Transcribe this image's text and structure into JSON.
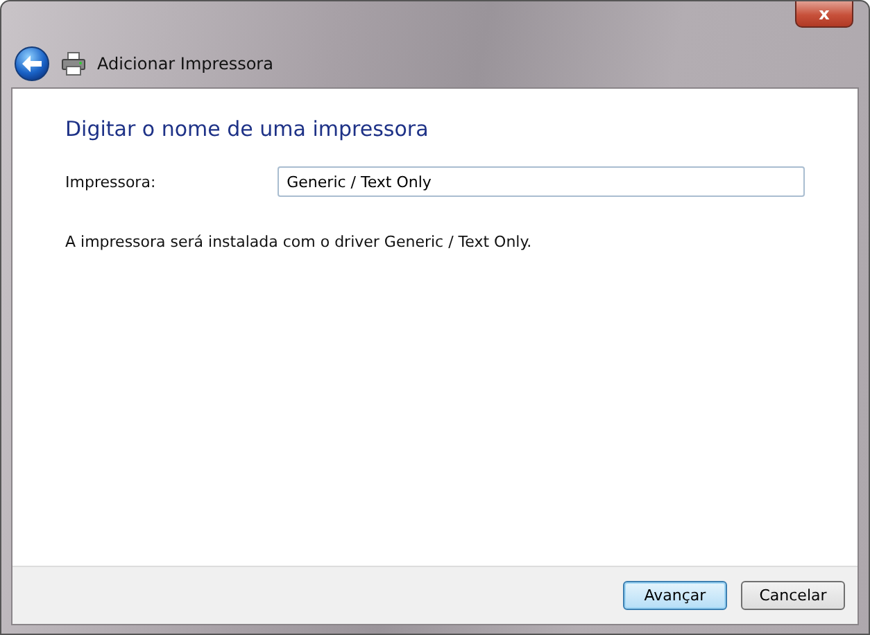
{
  "window": {
    "title": "Adicionar Impressora",
    "close": "x"
  },
  "heading": "Digitar o nome de uma impressora",
  "printer_field": {
    "label": "Impressora:",
    "value": "Generic / Text Only"
  },
  "info": "A impressora será instalada com o driver Generic / Text Only.",
  "buttons": [
    {
      "label": "Avançar",
      "kind": "default"
    },
    {
      "label": "Cancelar",
      "kind": "normal"
    }
  ]
}
